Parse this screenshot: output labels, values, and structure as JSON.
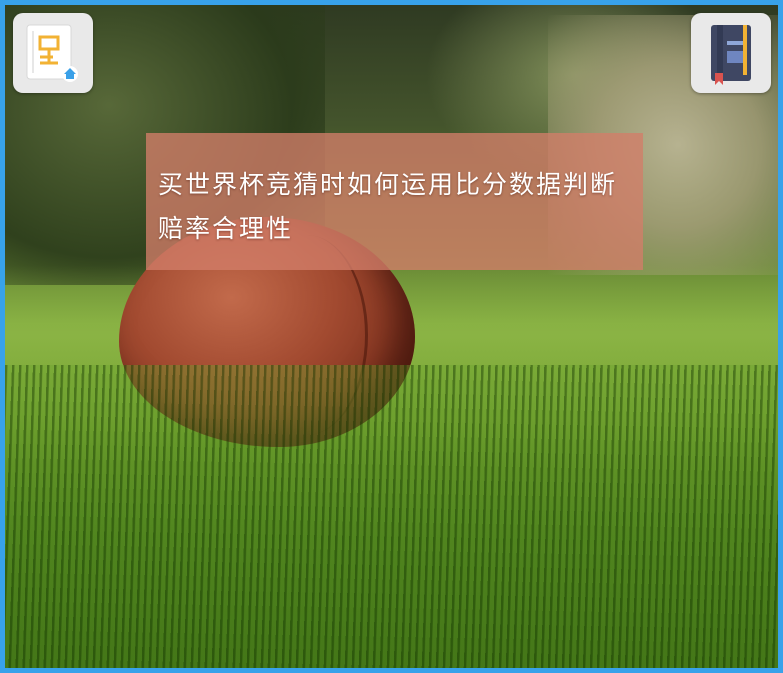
{
  "article": {
    "headline": "买世界杯竞猜时如何运用比分数据判断赔率合理性"
  },
  "nav": {
    "left_icon": "sitemap-home-icon",
    "right_icon": "book-icon"
  },
  "colors": {
    "border": "#38a2ea",
    "overlay": "#d27d69",
    "button_bg": "#e9e9e9"
  }
}
